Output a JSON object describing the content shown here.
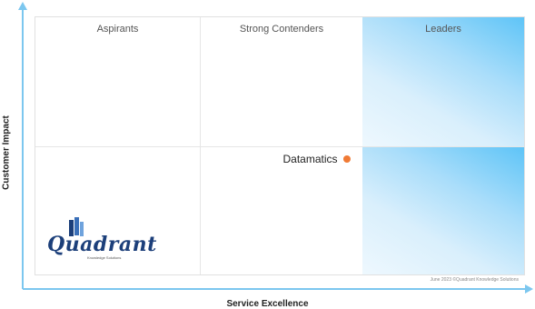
{
  "chart_data": {
    "type": "scatter",
    "xlabel": "Service Excellence",
    "ylabel": "Customer Impact",
    "quadrants": [
      "Aspirants",
      "Strong Contenders",
      "Leaders"
    ],
    "points": [
      {
        "label": "Datamatics",
        "x": 1.91,
        "y": 0.9
      }
    ],
    "xlim": [
      0,
      3
    ],
    "ylim": [
      0,
      2
    ],
    "grid": true,
    "colors": {
      "point": "#f07a35",
      "leaders_gradient": "#5ec4f7",
      "axis": "#7cc7ef"
    }
  },
  "footer": {
    "copyright": "June 2023 ©Quadrant Knowledge Solutions"
  },
  "logo": {
    "name": "Quadrant",
    "tagline": "Knowledge Solutions"
  }
}
